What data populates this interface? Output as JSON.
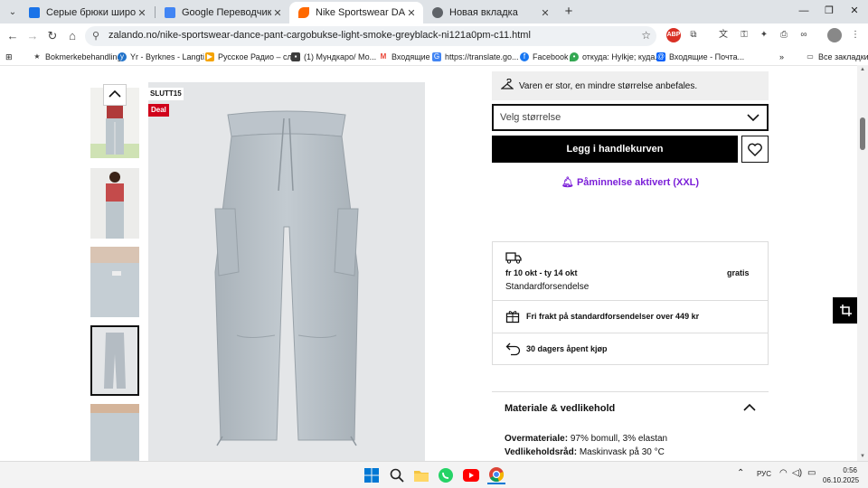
{
  "browser": {
    "tabs": [
      {
        "label": "Серые брюки широкого кроя",
        "color": "#1a73e8",
        "active": false
      },
      {
        "label": "Google Переводчик",
        "color": "#4285f4",
        "active": false
      },
      {
        "label": "Nike Sportswear DANCE PANT",
        "color": "#ff6900",
        "active": true
      },
      {
        "label": "Новая вкладка",
        "color": "#5f6368",
        "active": false
      }
    ],
    "url": "zalando.no/nike-sportswear-dance-pant-cargobukse-light-smoke-greyblack-ni121a0pm-c11.html",
    "bookmarks": [
      {
        "label": "Bokmerkebehandling",
        "icon": "star-icon"
      },
      {
        "label": "Yr - Byrknes - Langti...",
        "icon": "yr-icon"
      },
      {
        "label": "Русское Радио – сл...",
        "icon": "radio-icon"
      },
      {
        "label": "(1) Мундкаро/ Мо...",
        "icon": "folder-icon"
      },
      {
        "label": "Входящие",
        "icon": "gmail-icon"
      },
      {
        "label": "https://translate.go...",
        "icon": "translate-icon"
      },
      {
        "label": "Facebook",
        "icon": "facebook-icon"
      },
      {
        "label": "откуда: Hylkje; куда...",
        "icon": "maps-icon"
      },
      {
        "label": "Входящие - Почта...",
        "icon": "mail-icon"
      }
    ],
    "all_bookmarks": "Все закладки",
    "extension_badge": "ABP"
  },
  "product": {
    "sale_badge": "SLUTT15",
    "deal_badge": "Deal",
    "size_note": "Varen er stor, en mindre størrelse anbefales.",
    "size_placeholder": "Velg størrelse",
    "add_to_cart": "Legg i handlekurven",
    "reminder": "Påminnelse aktivert (XXL)"
  },
  "delivery": {
    "date": "fr 10 okt - ty 14 okt",
    "price": "gratis",
    "method": "Standardforsendelse",
    "free_shipping": "Fri frakt på standardforsendelser over 449 kr",
    "returns": "30 dagers åpent kjøp"
  },
  "material": {
    "title": "Materiale & vedlikehold",
    "outer_label": "Overmateriale:",
    "outer_value": "97% bomull, 3% elastan",
    "care_label": "Vedlikeholdsråd:",
    "care_value": "Maskinvask på 30 °C"
  },
  "taskbar": {
    "lang": "РУС",
    "time": "0:56",
    "date": "06.10.2025"
  }
}
